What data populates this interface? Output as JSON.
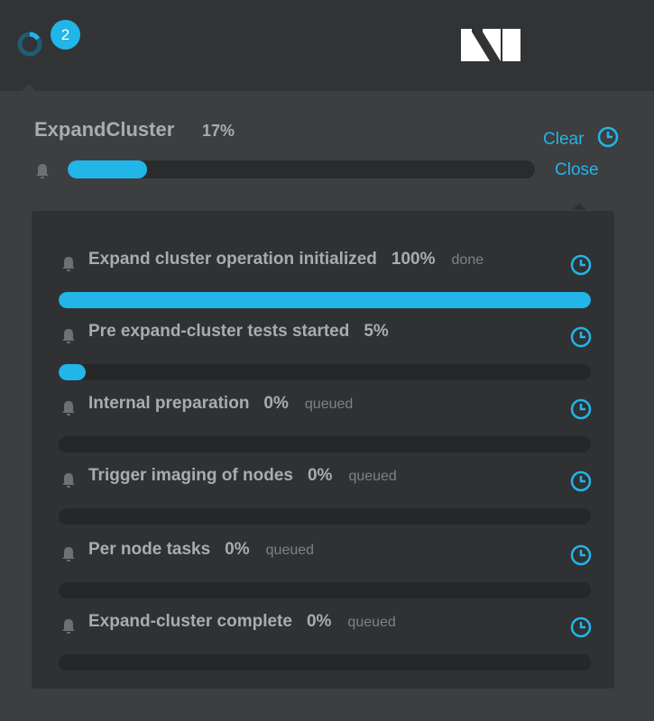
{
  "header": {
    "notification_count": "2"
  },
  "task": {
    "title": "ExpandCluster",
    "percent_label": "17%",
    "progress": 0.17
  },
  "actions": {
    "clear_label": "Clear",
    "close_label": "Close"
  },
  "steps": [
    {
      "label": "Expand cluster operation initialized",
      "percent_label": "100%",
      "status": "done",
      "progress": 1.0
    },
    {
      "label": "Pre expand-cluster tests started",
      "percent_label": "5%",
      "status": "",
      "progress": 0.05
    },
    {
      "label": "Internal preparation",
      "percent_label": "0%",
      "status": "queued",
      "progress": 0
    },
    {
      "label": "Trigger imaging of nodes",
      "percent_label": "0%",
      "status": "queued",
      "progress": 0
    },
    {
      "label": "Per node tasks",
      "percent_label": "0%",
      "status": "queued",
      "progress": 0
    },
    {
      "label": "Expand-cluster complete",
      "percent_label": "0%",
      "status": "queued",
      "progress": 0
    }
  ],
  "colors": {
    "accent": "#22b5e8",
    "background": "#3d3e40",
    "topbar": "#323335",
    "panel": "#303133",
    "track": "#262728",
    "text": "#a9acaf"
  },
  "icons": {
    "status": "progress-ring-icon",
    "logo": "nutanix-logo",
    "bell": "bell-icon",
    "clock": "clock-icon"
  }
}
